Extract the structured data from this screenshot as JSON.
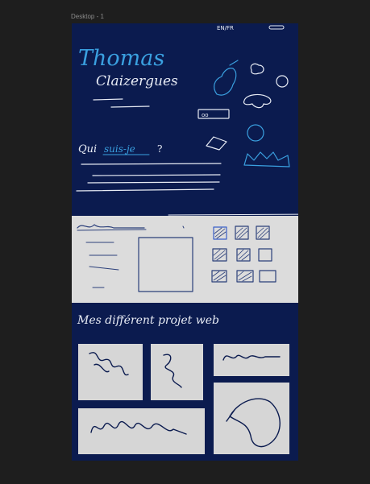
{
  "canvas": {
    "frame_label": "Desktop - 1"
  },
  "sketch": {
    "lang_switch": "EN/FR",
    "name_first": "Thomas",
    "name_last": "Claizergues",
    "about_prefix": "Qui",
    "about_highlight": "suis-je",
    "about_suffix": "?",
    "projects_heading": "Mes différent projet web",
    "icon_button_label": "oo"
  },
  "colors": {
    "canvas_bg": "#1e1e1e",
    "frame_bg": "#0b1b4f",
    "accent_blue": "#3aa0e0",
    "ink_white": "#e8ecf5",
    "panel_grey": "#d6d6d6"
  }
}
